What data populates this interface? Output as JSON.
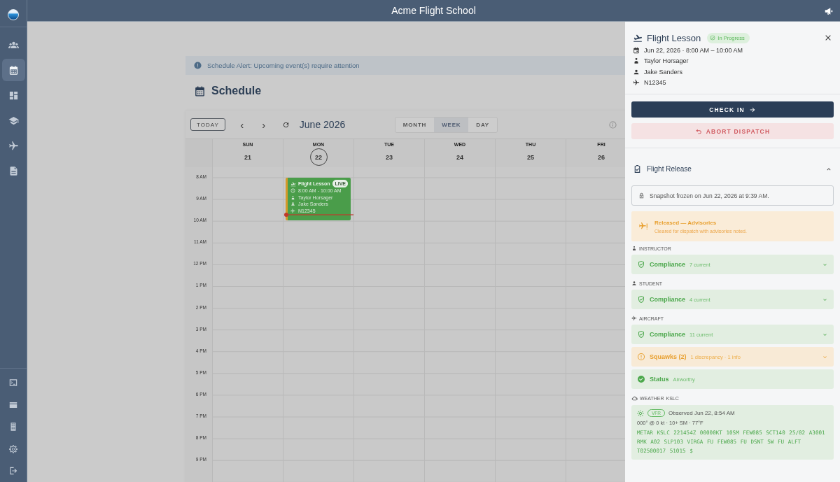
{
  "app": {
    "title": "Acme Flight School"
  },
  "sidebar": {
    "items": [
      {
        "selected": false
      },
      {
        "selected": true
      },
      {
        "selected": false
      },
      {
        "selected": false
      },
      {
        "selected": false
      },
      {
        "selected": false
      }
    ],
    "bottom_items": [
      {
        "selected": false
      },
      {
        "selected": false
      },
      {
        "selected": false
      },
      {
        "selected": false
      },
      {
        "selected": false
      }
    ]
  },
  "alert": {
    "text": "Schedule Alert: Upcoming event(s) require attention"
  },
  "page": {
    "title": "Schedule"
  },
  "calendar": {
    "today_button": "TODAY",
    "prev": "‹",
    "next": "›",
    "period": "June 2026",
    "views": [
      {
        "label": "MONTH",
        "selected": false
      },
      {
        "label": "WEEK",
        "selected": true
      },
      {
        "label": "DAY",
        "selected": false
      }
    ],
    "hours": [
      "8 AM",
      "9 AM",
      "10 AM",
      "11 AM",
      "12 PM",
      "1 PM",
      "2 PM",
      "3 PM",
      "4 PM",
      "5 PM",
      "6 PM",
      "7 PM",
      "8 PM",
      "9 PM"
    ],
    "days": [
      {
        "dow": "SUN",
        "date": "21",
        "today": false,
        "now_indicator": false
      },
      {
        "dow": "MON",
        "date": "22",
        "today": true,
        "now_indicator": true,
        "events": [
          {
            "title": "Flight Lesson",
            "badge": "LIVE",
            "time": "8:00 AM - 10:00 AM",
            "instructor": "Taylor Horsager",
            "student": "Jake Sanders",
            "aircraft": "N12345"
          }
        ]
      },
      {
        "dow": "TUE",
        "date": "23",
        "today": false,
        "now_indicator": false
      },
      {
        "dow": "WED",
        "date": "24",
        "today": false,
        "now_indicator": false
      },
      {
        "dow": "THU",
        "date": "25",
        "today": false,
        "now_indicator": false
      },
      {
        "dow": "FRI",
        "date": "26",
        "today": false,
        "now_indicator": false
      }
    ]
  },
  "panel": {
    "title": "Flight Lesson",
    "status": "In Progress",
    "details": [
      {
        "kind": "date",
        "text": "Jun 22, 2026 · 8:00 AM – 10:00 AM"
      },
      {
        "kind": "instructor",
        "text": "Taylor Horsager"
      },
      {
        "kind": "student",
        "text": "Jake Sanders"
      },
      {
        "kind": "aircraft",
        "text": "N12345"
      }
    ],
    "buttons": [
      {
        "kind": "primary",
        "label": "CHECK IN"
      },
      {
        "kind": "danger",
        "label": "ABORT DISPATCH"
      }
    ],
    "release": {
      "title": "Flight Release",
      "expanded": true,
      "snapshot": "Snapshot frozen on Jun 22, 2026 at 9:39 AM.",
      "advisory": {
        "title": "Released — Advisories",
        "text": "Cleared for dispatch with advisories noted."
      },
      "groups": [
        {
          "kind": "instructor",
          "label": "INSTRUCTOR",
          "cards": [
            {
              "kind": "ok",
              "title": "Compliance",
              "detail": "7 current"
            }
          ]
        },
        {
          "kind": "student",
          "label": "STUDENT",
          "cards": [
            {
              "kind": "ok",
              "title": "Compliance",
              "detail": "4 current"
            }
          ]
        },
        {
          "kind": "aircraft",
          "label": "AIRCRAFT",
          "cards": [
            {
              "kind": "ok",
              "title": "Compliance",
              "detail": "11 current"
            },
            {
              "kind": "warning",
              "title": "Squawks (2)",
              "detail": "1 discrepancy · 1 info"
            },
            {
              "kind": "status",
              "title": "Status",
              "detail": "Airworthy"
            }
          ]
        }
      ],
      "weather": {
        "label": "WEATHER",
        "station": "KSLC",
        "category": "VFR",
        "observed": "Observed Jun 22, 8:54 AM",
        "summary": "000° @ 0 kt · 10+ SM · 77°F",
        "metar": "METAR KSLC 221454Z 00000KT 10SM FEW085 SCT140 25/02 A3001 RMK A02 SLP103 VIRGA FU FEW085 FU DSNT SW FU ALFT T02500017 51015 $"
      }
    }
  }
}
